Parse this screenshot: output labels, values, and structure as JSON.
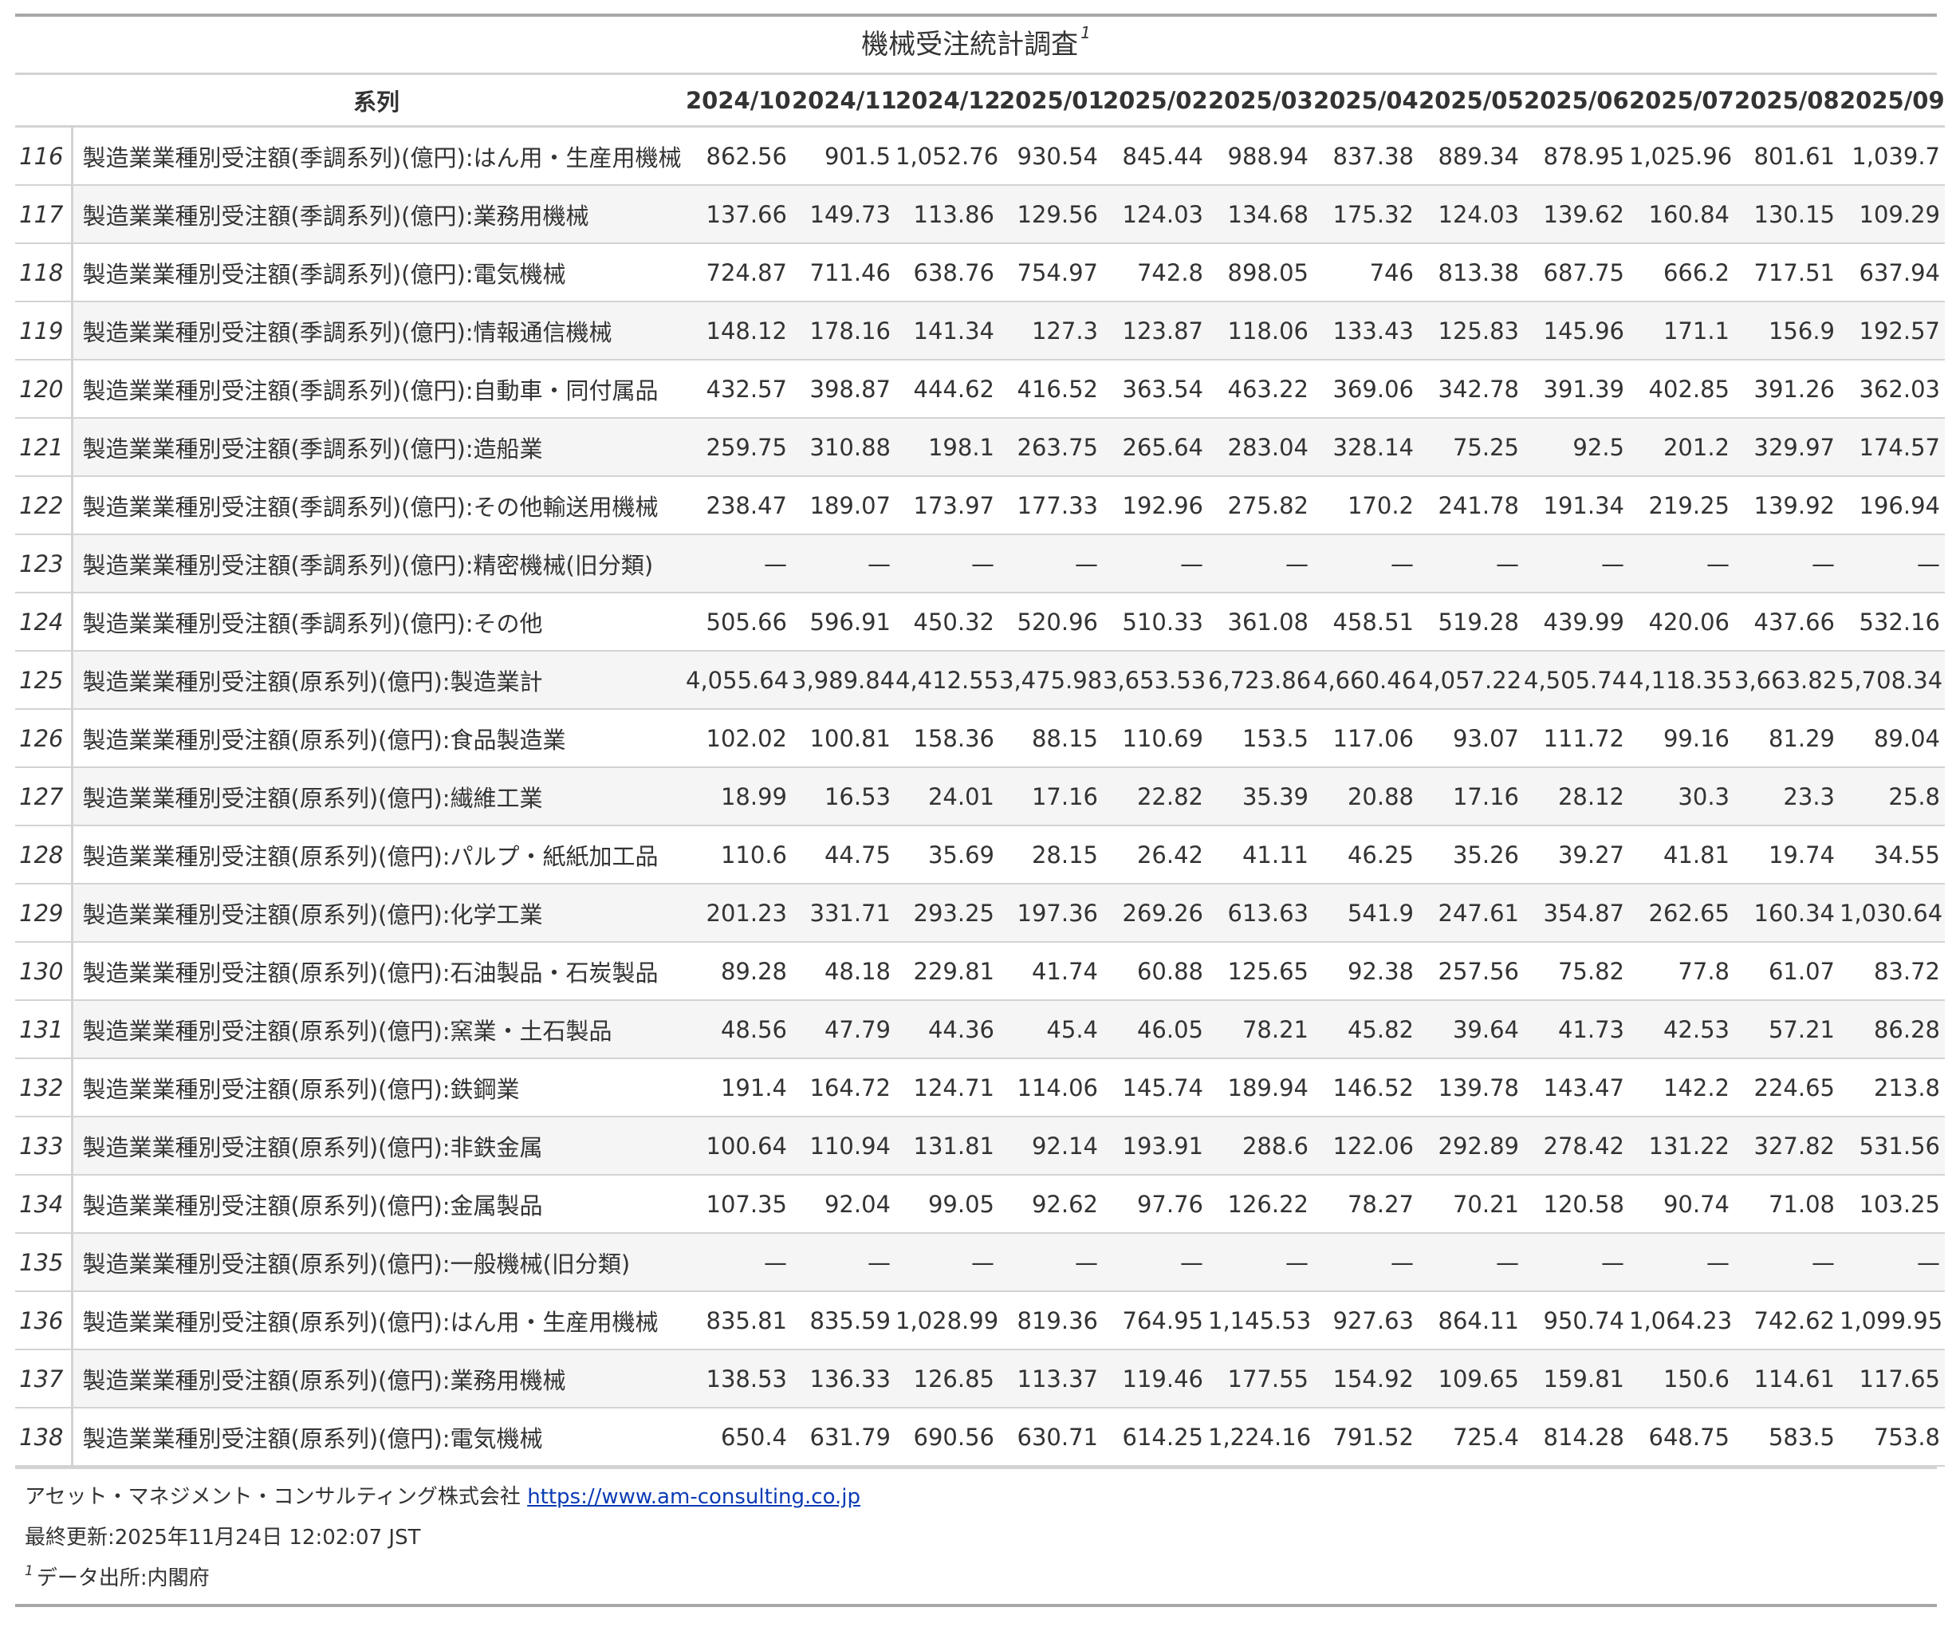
{
  "title": "機械受注統計調査",
  "title_footnote_mark": "1",
  "columns": {
    "series_header": "系列",
    "months": [
      "2024/10",
      "2024/11",
      "2024/12",
      "2025/01",
      "2025/02",
      "2025/03",
      "2025/04",
      "2025/05",
      "2025/06",
      "2025/07",
      "2025/08",
      "2025/09"
    ]
  },
  "rows": [
    {
      "id": "116",
      "name": "製造業業種別受注額(季調系列)(億円):はん用・生産用機械",
      "values": [
        "862.56",
        "901.5",
        "1,052.76",
        "930.54",
        "845.44",
        "988.94",
        "837.38",
        "889.34",
        "878.95",
        "1,025.96",
        "801.61",
        "1,039.7"
      ]
    },
    {
      "id": "117",
      "name": "製造業業種別受注額(季調系列)(億円):業務用機械",
      "values": [
        "137.66",
        "149.73",
        "113.86",
        "129.56",
        "124.03",
        "134.68",
        "175.32",
        "124.03",
        "139.62",
        "160.84",
        "130.15",
        "109.29"
      ]
    },
    {
      "id": "118",
      "name": "製造業業種別受注額(季調系列)(億円):電気機械",
      "values": [
        "724.87",
        "711.46",
        "638.76",
        "754.97",
        "742.8",
        "898.05",
        "746",
        "813.38",
        "687.75",
        "666.2",
        "717.51",
        "637.94"
      ]
    },
    {
      "id": "119",
      "name": "製造業業種別受注額(季調系列)(億円):情報通信機械",
      "values": [
        "148.12",
        "178.16",
        "141.34",
        "127.3",
        "123.87",
        "118.06",
        "133.43",
        "125.83",
        "145.96",
        "171.1",
        "156.9",
        "192.57"
      ]
    },
    {
      "id": "120",
      "name": "製造業業種別受注額(季調系列)(億円):自動車・同付属品",
      "values": [
        "432.57",
        "398.87",
        "444.62",
        "416.52",
        "363.54",
        "463.22",
        "369.06",
        "342.78",
        "391.39",
        "402.85",
        "391.26",
        "362.03"
      ]
    },
    {
      "id": "121",
      "name": "製造業業種別受注額(季調系列)(億円):造船業",
      "values": [
        "259.75",
        "310.88",
        "198.1",
        "263.75",
        "265.64",
        "283.04",
        "328.14",
        "75.25",
        "92.5",
        "201.2",
        "329.97",
        "174.57"
      ]
    },
    {
      "id": "122",
      "name": "製造業業種別受注額(季調系列)(億円):その他輸送用機械",
      "values": [
        "238.47",
        "189.07",
        "173.97",
        "177.33",
        "192.96",
        "275.82",
        "170.2",
        "241.78",
        "191.34",
        "219.25",
        "139.92",
        "196.94"
      ]
    },
    {
      "id": "123",
      "name": "製造業業種別受注額(季調系列)(億円):精密機械(旧分類)",
      "values": [
        "—",
        "—",
        "—",
        "—",
        "—",
        "—",
        "—",
        "—",
        "—",
        "—",
        "—",
        "—"
      ]
    },
    {
      "id": "124",
      "name": "製造業業種別受注額(季調系列)(億円):その他",
      "values": [
        "505.66",
        "596.91",
        "450.32",
        "520.96",
        "510.33",
        "361.08",
        "458.51",
        "519.28",
        "439.99",
        "420.06",
        "437.66",
        "532.16"
      ]
    },
    {
      "id": "125",
      "name": "製造業業種別受注額(原系列)(億円):製造業計",
      "values": [
        "4,055.64",
        "3,989.84",
        "4,412.55",
        "3,475.98",
        "3,653.53",
        "6,723.86",
        "4,660.46",
        "4,057.22",
        "4,505.74",
        "4,118.35",
        "3,663.82",
        "5,708.34"
      ]
    },
    {
      "id": "126",
      "name": "製造業業種別受注額(原系列)(億円):食品製造業",
      "values": [
        "102.02",
        "100.81",
        "158.36",
        "88.15",
        "110.69",
        "153.5",
        "117.06",
        "93.07",
        "111.72",
        "99.16",
        "81.29",
        "89.04"
      ]
    },
    {
      "id": "127",
      "name": "製造業業種別受注額(原系列)(億円):繊維工業",
      "values": [
        "18.99",
        "16.53",
        "24.01",
        "17.16",
        "22.82",
        "35.39",
        "20.88",
        "17.16",
        "28.12",
        "30.3",
        "23.3",
        "25.8"
      ]
    },
    {
      "id": "128",
      "name": "製造業業種別受注額(原系列)(億円):パルプ・紙紙加工品",
      "values": [
        "110.6",
        "44.75",
        "35.69",
        "28.15",
        "26.42",
        "41.11",
        "46.25",
        "35.26",
        "39.27",
        "41.81",
        "19.74",
        "34.55"
      ]
    },
    {
      "id": "129",
      "name": "製造業業種別受注額(原系列)(億円):化学工業",
      "values": [
        "201.23",
        "331.71",
        "293.25",
        "197.36",
        "269.26",
        "613.63",
        "541.9",
        "247.61",
        "354.87",
        "262.65",
        "160.34",
        "1,030.64"
      ]
    },
    {
      "id": "130",
      "name": "製造業業種別受注額(原系列)(億円):石油製品・石炭製品",
      "values": [
        "89.28",
        "48.18",
        "229.81",
        "41.74",
        "60.88",
        "125.65",
        "92.38",
        "257.56",
        "75.82",
        "77.8",
        "61.07",
        "83.72"
      ]
    },
    {
      "id": "131",
      "name": "製造業業種別受注額(原系列)(億円):窯業・土石製品",
      "values": [
        "48.56",
        "47.79",
        "44.36",
        "45.4",
        "46.05",
        "78.21",
        "45.82",
        "39.64",
        "41.73",
        "42.53",
        "57.21",
        "86.28"
      ]
    },
    {
      "id": "132",
      "name": "製造業業種別受注額(原系列)(億円):鉄鋼業",
      "values": [
        "191.4",
        "164.72",
        "124.71",
        "114.06",
        "145.74",
        "189.94",
        "146.52",
        "139.78",
        "143.47",
        "142.2",
        "224.65",
        "213.8"
      ]
    },
    {
      "id": "133",
      "name": "製造業業種別受注額(原系列)(億円):非鉄金属",
      "values": [
        "100.64",
        "110.94",
        "131.81",
        "92.14",
        "193.91",
        "288.6",
        "122.06",
        "292.89",
        "278.42",
        "131.22",
        "327.82",
        "531.56"
      ]
    },
    {
      "id": "134",
      "name": "製造業業種別受注額(原系列)(億円):金属製品",
      "values": [
        "107.35",
        "92.04",
        "99.05",
        "92.62",
        "97.76",
        "126.22",
        "78.27",
        "70.21",
        "120.58",
        "90.74",
        "71.08",
        "103.25"
      ]
    },
    {
      "id": "135",
      "name": "製造業業種別受注額(原系列)(億円):一般機械(旧分類)",
      "values": [
        "—",
        "—",
        "—",
        "—",
        "—",
        "—",
        "—",
        "—",
        "—",
        "—",
        "—",
        "—"
      ]
    },
    {
      "id": "136",
      "name": "製造業業種別受注額(原系列)(億円):はん用・生産用機械",
      "values": [
        "835.81",
        "835.59",
        "1,028.99",
        "819.36",
        "764.95",
        "1,145.53",
        "927.63",
        "864.11",
        "950.74",
        "1,064.23",
        "742.62",
        "1,099.95"
      ]
    },
    {
      "id": "137",
      "name": "製造業業種別受注額(原系列)(億円):業務用機械",
      "values": [
        "138.53",
        "136.33",
        "126.85",
        "113.37",
        "119.46",
        "177.55",
        "154.92",
        "109.65",
        "159.81",
        "150.6",
        "114.61",
        "117.65"
      ]
    },
    {
      "id": "138",
      "name": "製造業業種別受注額(原系列)(億円):電気機械",
      "values": [
        "650.4",
        "631.79",
        "690.56",
        "630.71",
        "614.25",
        "1,224.16",
        "791.52",
        "725.4",
        "814.28",
        "648.75",
        "583.5",
        "753.8"
      ]
    }
  ],
  "footer": {
    "company": "アセット・マネジメント・コンサルティング株式会社",
    "link_text": "https://www.am-consulting.co.jp",
    "updated": "最終更新:2025年11月24日 12:02:07 JST",
    "note_mark": "1",
    "source": "データ出所:内閣府"
  },
  "colors": {
    "text": "#333333",
    "stripe": "#f5f5f5",
    "rule": "#d3d3d3",
    "heavy_rule": "#a8a8a8",
    "link": "#0b3bb5"
  }
}
